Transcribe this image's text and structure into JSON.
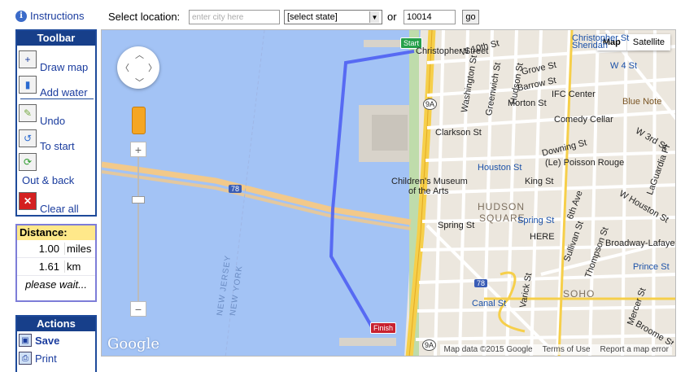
{
  "top": {
    "instructions": "Instructions",
    "select_location": "Select location:",
    "city_placeholder": "enter city here",
    "state_value": "[select state]",
    "or": "or",
    "zip_value": "10014",
    "go": "go"
  },
  "toolbar": {
    "title": "Toolbar",
    "draw_map": "Draw map",
    "add_water": "Add water",
    "undo": "Undo",
    "to_start": "To start",
    "out_back": "Out & back",
    "clear_all": "Clear all"
  },
  "distance": {
    "title": "Distance:",
    "miles_value": "1.00",
    "miles_unit": "miles",
    "km_value": "1.61",
    "km_unit": "km",
    "status": "please wait..."
  },
  "actions": {
    "title": "Actions",
    "save": "Save",
    "print": "Print"
  },
  "map": {
    "type_map": "Map",
    "type_satellite": "Satellite",
    "start_label": "Start",
    "finish_label": "Finish",
    "google": "Google",
    "attribution": "Map data ©2015 Google",
    "terms": "Terms of Use",
    "report": "Report a map error",
    "labels": {
      "christopher_st": "Christopher Street",
      "christopher_st2": "Christopher St",
      "sheridan": "Sheridan",
      "w10": "W 10th St",
      "grove": "Grove St",
      "barrow": "Barrow St",
      "morton": "Morton St",
      "w4": "W 4 St",
      "ifc": "IFC Center",
      "blue_note": "Blue Note",
      "comedy": "Comedy Cellar",
      "clarkson": "Clarkson St",
      "downing": "Downing St",
      "w3": "W 3rd St",
      "houston_st": "Houston St",
      "poisson": "(Le) Poisson Rouge",
      "king": "King St",
      "childrens": "Children's Museum",
      "of_the_arts": "of the Arts",
      "hudson_nb": "HUDSON",
      "square_nb": "SQUARE",
      "spring_st": "Spring St",
      "spring_station": "Spring St",
      "here": "HERE",
      "broadway_lafayette": "Broadway-Lafayet",
      "prince": "Prince St",
      "soho": "SOHO",
      "canal": "Canal St",
      "w_houston": "W Houston St",
      "new_jersey": "NEW JERSEY",
      "new_york": "NEW YORK",
      "i78": "78",
      "i78b": "78",
      "r9a": "9A",
      "r9a2": "9A",
      "r9a3": "9A",
      "hudson_st": "Hudson St",
      "washington": "Washington St",
      "greenwich": "Greenwich St",
      "varick": "Varick St",
      "sixth": "6th Ave",
      "thompson": "Thompson St",
      "sullivan": "Sullivan St",
      "mercer": "Mercer St",
      "broome": "Broome St",
      "laguardia": "LaGuardia Pl",
      "w_st": "West St"
    }
  }
}
